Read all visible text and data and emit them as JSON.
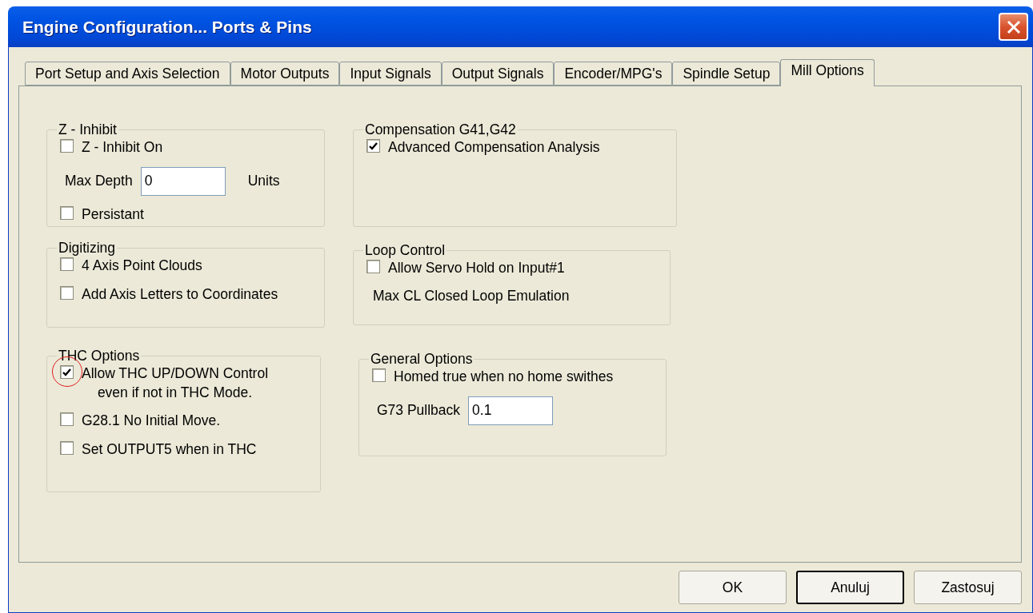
{
  "window": {
    "title": "Engine Configuration... Ports & Pins"
  },
  "tabs": [
    {
      "label": "Port Setup and Axis Selection",
      "selected": false
    },
    {
      "label": "Motor Outputs",
      "selected": false
    },
    {
      "label": "Input Signals",
      "selected": false
    },
    {
      "label": "Output Signals",
      "selected": false
    },
    {
      "label": "Encoder/MPG's",
      "selected": false
    },
    {
      "label": "Spindle Setup",
      "selected": false
    },
    {
      "label": "Mill Options",
      "selected": true
    }
  ],
  "left_groups": [
    {
      "title": "Z - Inhibit",
      "items": [
        {
          "kind": "checkbox",
          "label": "Z - Inhibit On",
          "checked": false,
          "highlighted": false
        },
        {
          "kind": "field",
          "label": "Max Depth",
          "value": "0",
          "unit": "Units"
        },
        {
          "kind": "checkbox",
          "label": "Persistant",
          "checked": false,
          "highlighted": false
        }
      ]
    },
    {
      "title": "Digitizing",
      "items": [
        {
          "kind": "checkbox",
          "label": "4 Axis Point Clouds",
          "checked": false,
          "highlighted": false
        },
        {
          "kind": "checkbox",
          "label": "Add Axis Letters to Coordinates",
          "checked": false,
          "highlighted": false
        }
      ]
    },
    {
      "title": "THC Options",
      "items": [
        {
          "kind": "checkbox",
          "label": "Allow THC UP/DOWN Control\neven if not in THC Mode.",
          "checked": true,
          "highlighted": true
        },
        {
          "kind": "checkbox",
          "label": "G28.1 No Initial Move.",
          "checked": false,
          "highlighted": false
        },
        {
          "kind": "checkbox",
          "label": "Set OUTPUT5 when in THC",
          "checked": false,
          "highlighted": false
        }
      ]
    }
  ],
  "right_groups": [
    {
      "title": "Compensation G41,G42",
      "items": [
        {
          "kind": "checkbox",
          "label": "Advanced Compensation Analysis",
          "checked": true,
          "highlighted": false
        }
      ]
    },
    {
      "title": "Loop Control",
      "items": [
        {
          "kind": "checkbox",
          "label": "Allow Servo Hold on Input#1",
          "checked": false,
          "highlighted": false
        },
        {
          "kind": "text",
          "label": "Max CL Closed Loop Emulation"
        }
      ]
    },
    {
      "title": "General Options",
      "items": [
        {
          "kind": "checkbox",
          "label": "Homed true when no home swithes",
          "checked": false,
          "highlighted": false
        },
        {
          "kind": "field",
          "label": "G73 Pullback",
          "value": "0.1"
        }
      ]
    }
  ],
  "buttons": [
    {
      "label": "OK",
      "default": false
    },
    {
      "label": "Anuluj",
      "default": true
    },
    {
      "label": "Zastosuj",
      "default": false
    }
  ]
}
